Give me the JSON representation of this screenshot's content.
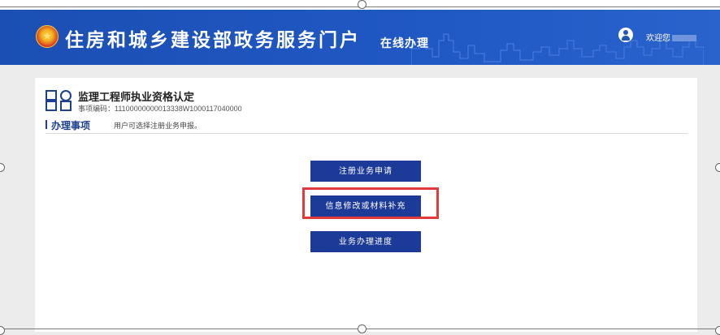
{
  "header": {
    "title": "住房和城乡建设部政务服务门户",
    "subtitle": "在线办理",
    "welcome": "欢迎您"
  },
  "item": {
    "title": "监理工程师执业资格认定",
    "code": "事项编码：11100000000013338W1000117040000"
  },
  "section": {
    "title": "办理事项",
    "note": "用户可选择注册业务申报。"
  },
  "buttons": [
    {
      "label": "注册业务申请"
    },
    {
      "label": "信息修改或材料补充"
    },
    {
      "label": "业务办理进度"
    }
  ],
  "colors": {
    "header_blue": "#2058c4",
    "button_navy": "#1c3a98",
    "highlight_red": "#e23a3a"
  }
}
